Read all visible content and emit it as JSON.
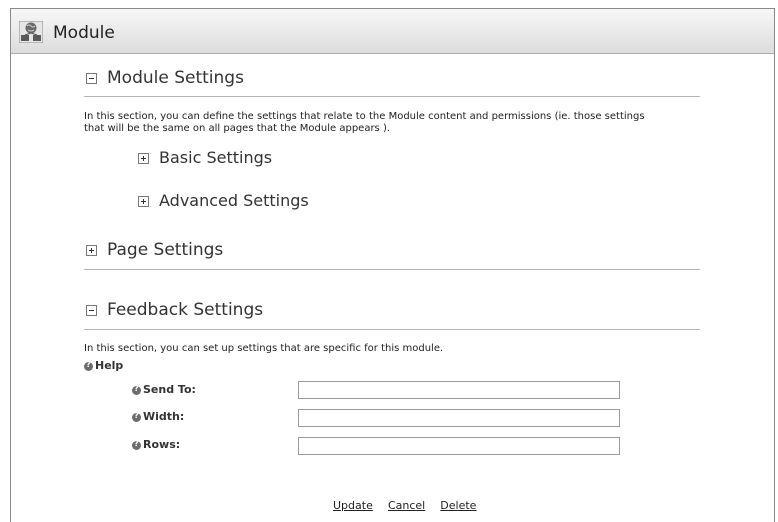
{
  "module": {
    "icon": "module-globe-icon",
    "title": "Module"
  },
  "module_settings": {
    "heading": "Module Settings",
    "description_line1": "In this section, you can define the settings that relate to the Module content and permissions (ie. those settings",
    "description_line2": "that will be the same on all pages that the Module appears ).",
    "basic_label": "Basic Settings",
    "advanced_label": "Advanced Settings"
  },
  "page_settings": {
    "heading": "Page Settings"
  },
  "feedback_settings": {
    "heading": "Feedback Settings",
    "description": "In this section, you can set up settings that are specific for this module.",
    "help_label": "Help",
    "fields": {
      "send_to": {
        "label": "Send To:",
        "value": ""
      },
      "width": {
        "label": "Width:",
        "value": ""
      },
      "rows": {
        "label": "Rows:",
        "value": ""
      }
    }
  },
  "actions": {
    "update": "Update",
    "cancel": "Cancel",
    "delete": "Delete"
  }
}
